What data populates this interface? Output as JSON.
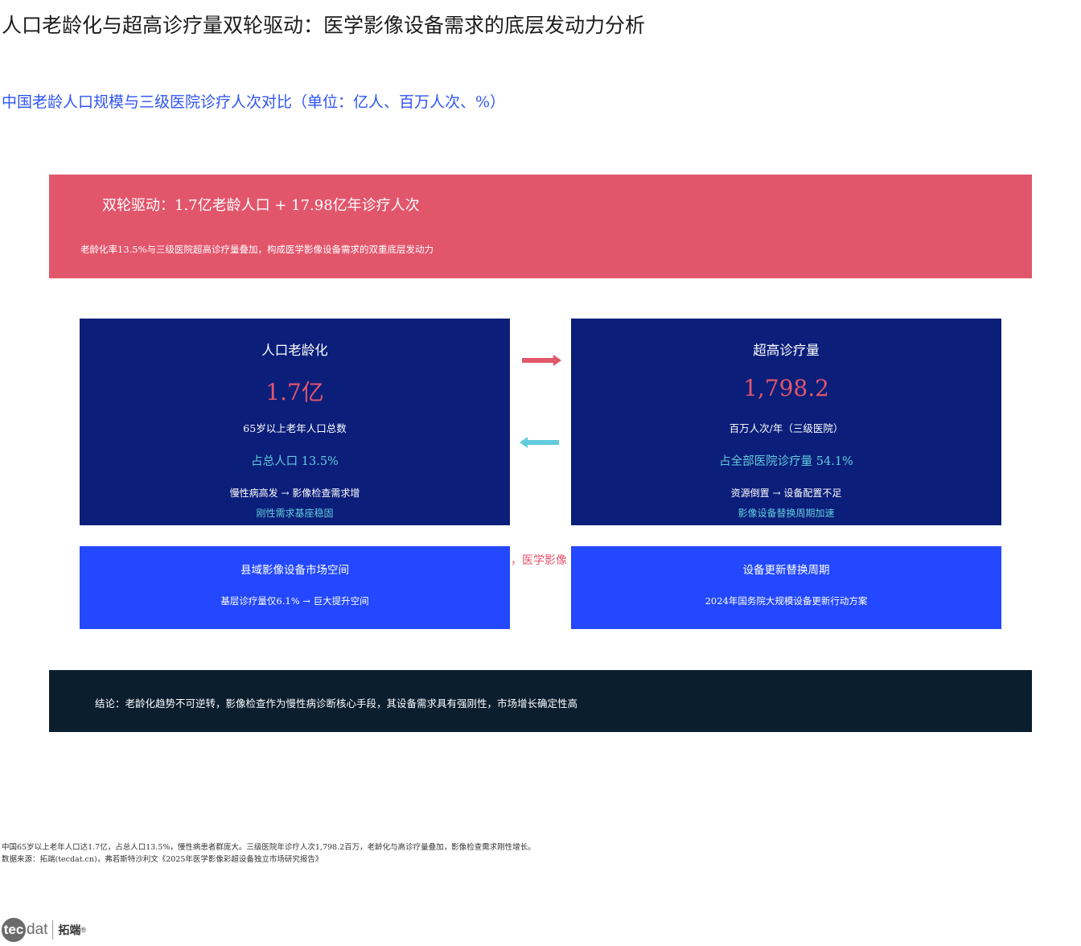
{
  "title": "人口老龄化与超高诊疗量双轮驱动：医学影像设备需求的底层发动力分析",
  "subtitle": "中国老龄人口规模与三级医院诊疗人次对比（单位：亿人、百万人次、%）",
  "banner": {
    "headline": "双轮驱动：1.7亿老龄人口 + 17.98亿年诊疗人次",
    "sub": "老龄化率13.5%与三级医院超高诊疗量叠加，构成医学影像设备需求的双重底层发动力",
    "color": "#e2566c"
  },
  "cards": [
    {
      "title": "人口老龄化",
      "value": "1.7亿",
      "desc": "65岁以上老年人口总数",
      "share": "占总人口 13.5%",
      "chain": "慢性病高发 → 影像检查需求增",
      "note": "刚性需求基座稳固"
    },
    {
      "title": "超高诊疗量",
      "value": "1,798.2",
      "desc": "百万人次/年（三级医院）",
      "share": "占全部医院诊疗量 54.1%",
      "chain": "资源倒置 → 设备配置不足",
      "note": "影像设备替换周期加速"
    }
  ],
  "arrows": {
    "right_color": "#e2566c",
    "left_color": "#62ccdc"
  },
  "mid_text": "，医学影像",
  "boxes": [
    {
      "title": "县域影像设备市场空间",
      "desc": "基层诊疗量仅6.1% → 巨大提升空间"
    },
    {
      "title": "设备更新替换周期",
      "desc": "2024年国务院大规模设备更新行动方案"
    }
  ],
  "conclusion": "结论：老龄化趋势不可逆转，影像检查作为慢性病诊断核心手段，其设备需求具有强刚性，市场增长确定性高",
  "footnote": "中国65岁以上老年人口达1.7亿，占总人口13.5%，慢性病患者群庞大。三级医院年诊疗人次1,798.2百万，老龄化与高诊疗量叠加，影像检查需求刚性增长。",
  "source": "数据来源：拓端(tecdat.cn)，弗若斯特沙利文《2025年医学影像彩超设备独立市场研究报告》",
  "logo": {
    "circle": "tec",
    "dat": "dat",
    "cn": "拓端",
    "reg": "®"
  }
}
